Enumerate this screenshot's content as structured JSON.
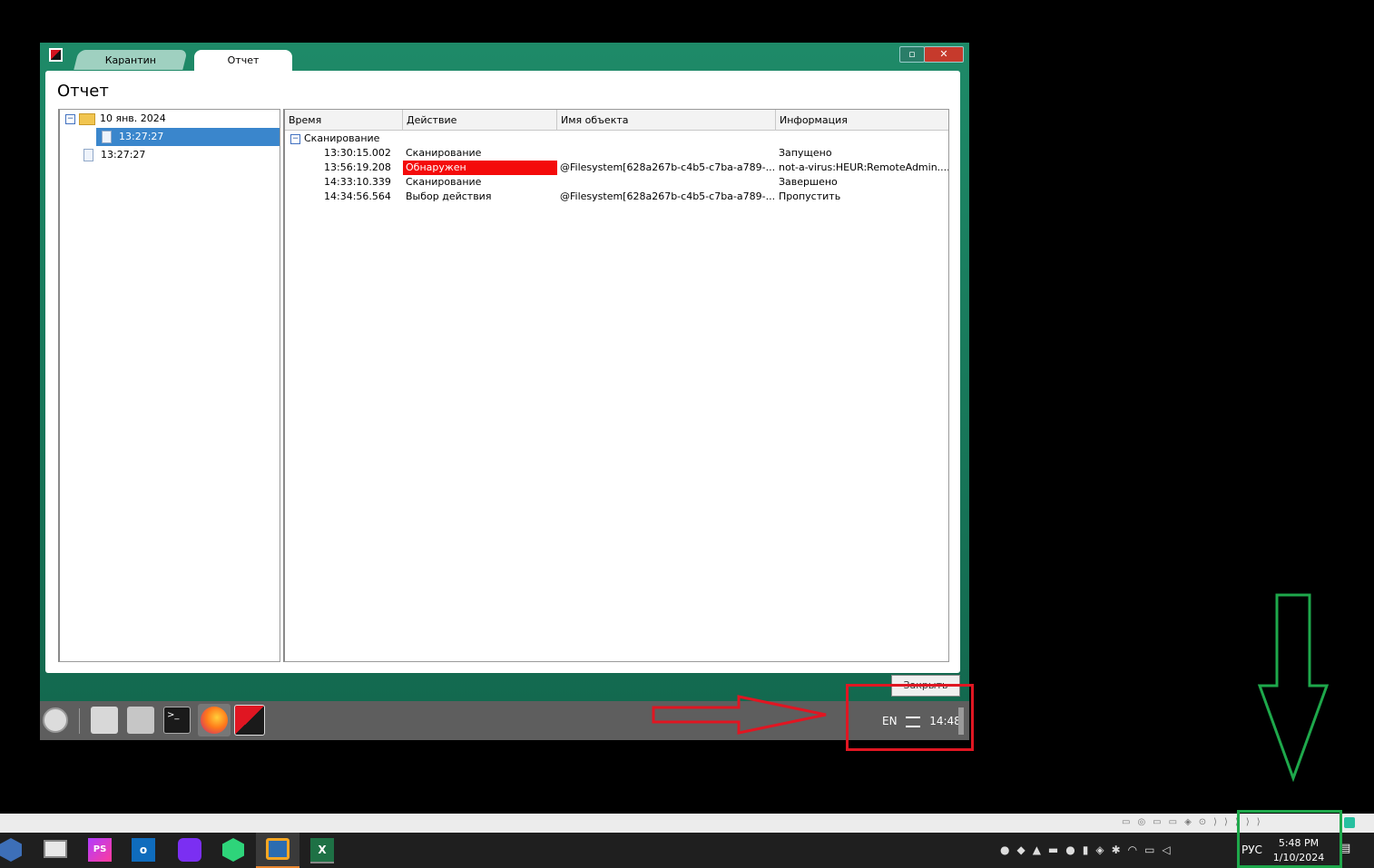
{
  "window": {
    "tabs": [
      "Карантин",
      "Отчет"
    ],
    "title": "Отчет",
    "close_button": "Закрыть"
  },
  "tree": {
    "root": "10 янв. 2024",
    "items": [
      "13:27:27",
      "13:27:27"
    ]
  },
  "table": {
    "columns": [
      "Время",
      "Действие",
      "Имя объекта",
      "Информация"
    ],
    "group": "Сканирование",
    "rows": [
      {
        "time": "13:30:15.002",
        "action": "Сканирование",
        "object": "",
        "info": "Запущено"
      },
      {
        "time": "13:56:19.208",
        "action": "Обнаружен",
        "object": "@Filesystem[628a267b-c4b5-c7ba-a789-...",
        "info": "not-a-virus:HEUR:RemoteAdmin...."
      },
      {
        "time": "14:33:10.339",
        "action": "Сканирование",
        "object": "",
        "info": "Завершено"
      },
      {
        "time": "14:34:56.564",
        "action": "Выбор действия",
        "object": "@Filesystem[628a267b-c4b5-c7ba-a789-...",
        "info": "Пропустить"
      }
    ],
    "highlight_color": "#f40b0b"
  },
  "vm_taskbar": {
    "lang": "EN",
    "time": "14:48"
  },
  "host_taskbar": {
    "lang": "РУС",
    "time": "5:48 PM",
    "date": "1/10/2024"
  },
  "annotations": {
    "red_color": "#e01622",
    "green_color": "#1ea84b"
  }
}
